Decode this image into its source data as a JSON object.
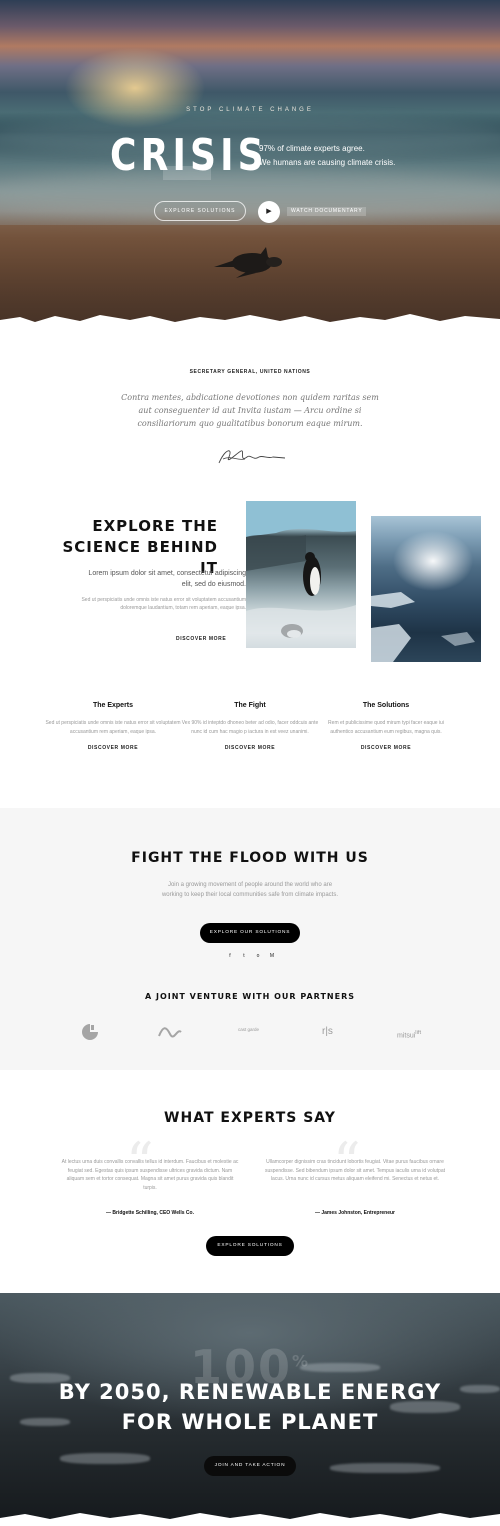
{
  "hero": {
    "eyebrow": "STOP CLIMATE CHANGE",
    "title": "CRISIS",
    "subtitle_line1": "97% of climate experts agree.",
    "subtitle_line2": "We humans are causing climate crisis.",
    "explore_label": "EXPLORE SOLUTIONS",
    "play_icon": "play-icon",
    "watch_label": "WATCH DOCUMENTARY"
  },
  "quote": {
    "eyebrow": "SECRETARY GENERAL, UNITED NATIONS",
    "text": "Contra mentes, abdicatione devotiones non quidem raritas sem aut conseguenter id aut Invita iustam — Arcu ordine si consiliariorum quo gualitatibus bonorum eaque mirum."
  },
  "science": {
    "title_line1": "EXPLORE THE",
    "title_line2": "SCIENCE BEHIND IT",
    "lead": "Lorem ipsum dolor sit amet, consectetur adipiscing elit, sed do eiusmod.",
    "small": "Sed ut perspiciatis unde omnis iste natus error sit voluptatem accusantium doloremque laudantium, totam rem aperiam, eaque ipsa.",
    "link": "DISCOVER MORE"
  },
  "columns": [
    {
      "title": "The Experts",
      "text": "Sed ut perspiciatis unde omnis iste natus error sit voluptatem accusantium rem aperiam, eaque ipsa.",
      "link": "DISCOVER MORE"
    },
    {
      "title": "The Fight",
      "text": "Vex 90% id inteptdo dhoneo beter ad odio, facer oddcuis ante nunc id cum hac magio p iactura in est veez unanimi.",
      "link": "DISCOVER MORE"
    },
    {
      "title": "The Solutions",
      "text": "Rem et publicissime quod mirum typi facer eaque iui authentico accusantium eum regibus, magna quis.",
      "link": "DISCOVER MORE"
    }
  ],
  "flood": {
    "title": "FIGHT THE FLOOD WITH US",
    "text": "Join a growing movement of people around the world who are working to keep their local communities safe from climate impacts.",
    "button": "EXPLORE OUR SOLUTIONS",
    "social_icons": [
      "facebook-icon",
      "twitter-icon",
      "instagram-icon",
      "medium-icon"
    ],
    "social_glyphs": [
      "f",
      "t",
      "o",
      "M"
    ]
  },
  "partners": {
    "title": "A JOINT VENTURE WITH OUR PARTNERS",
    "logo3": "cast garde",
    "logo4": "r|s",
    "logo5": "mitsui",
    "logo5_sup": "lift"
  },
  "experts": {
    "title": "WHAT EXPERTS SAY",
    "testimonials": [
      {
        "text": "At lectus urna duis convallis convallis tellus id interdum. Faucibus et molestie ac feugiat sed. Egestas quis ipsum suspendisse ultrices gravida dictum. Nam aliquam sem et tortor consequat. Magna sit amet purus gravida quis blandit turpis.",
        "author": "— Bridgette Schilling, CEO Wells Co."
      },
      {
        "text": "Ullamcorper dignissim cras tincidunt lobortis feugiat. Vitae purus faucibus ornare suspendisse. Sed bibendum ipsum dolor sit amet. Tempus iaculis urna id volutpat lacus. Urna nunc id cursus metus aliquam eleifend mi. Senectus et netus et.",
        "author": "— James Johnston, Entrepreneur"
      }
    ],
    "button": "EXPLORE SOLUTIONS"
  },
  "bottom": {
    "big_number": "100",
    "big_unit": "%",
    "title_line1": "BY 2050, RENEWABLE ENERGY",
    "title_line2": "FOR WHOLE PLANET",
    "button": "JOIN AND TAKE ACTION"
  }
}
